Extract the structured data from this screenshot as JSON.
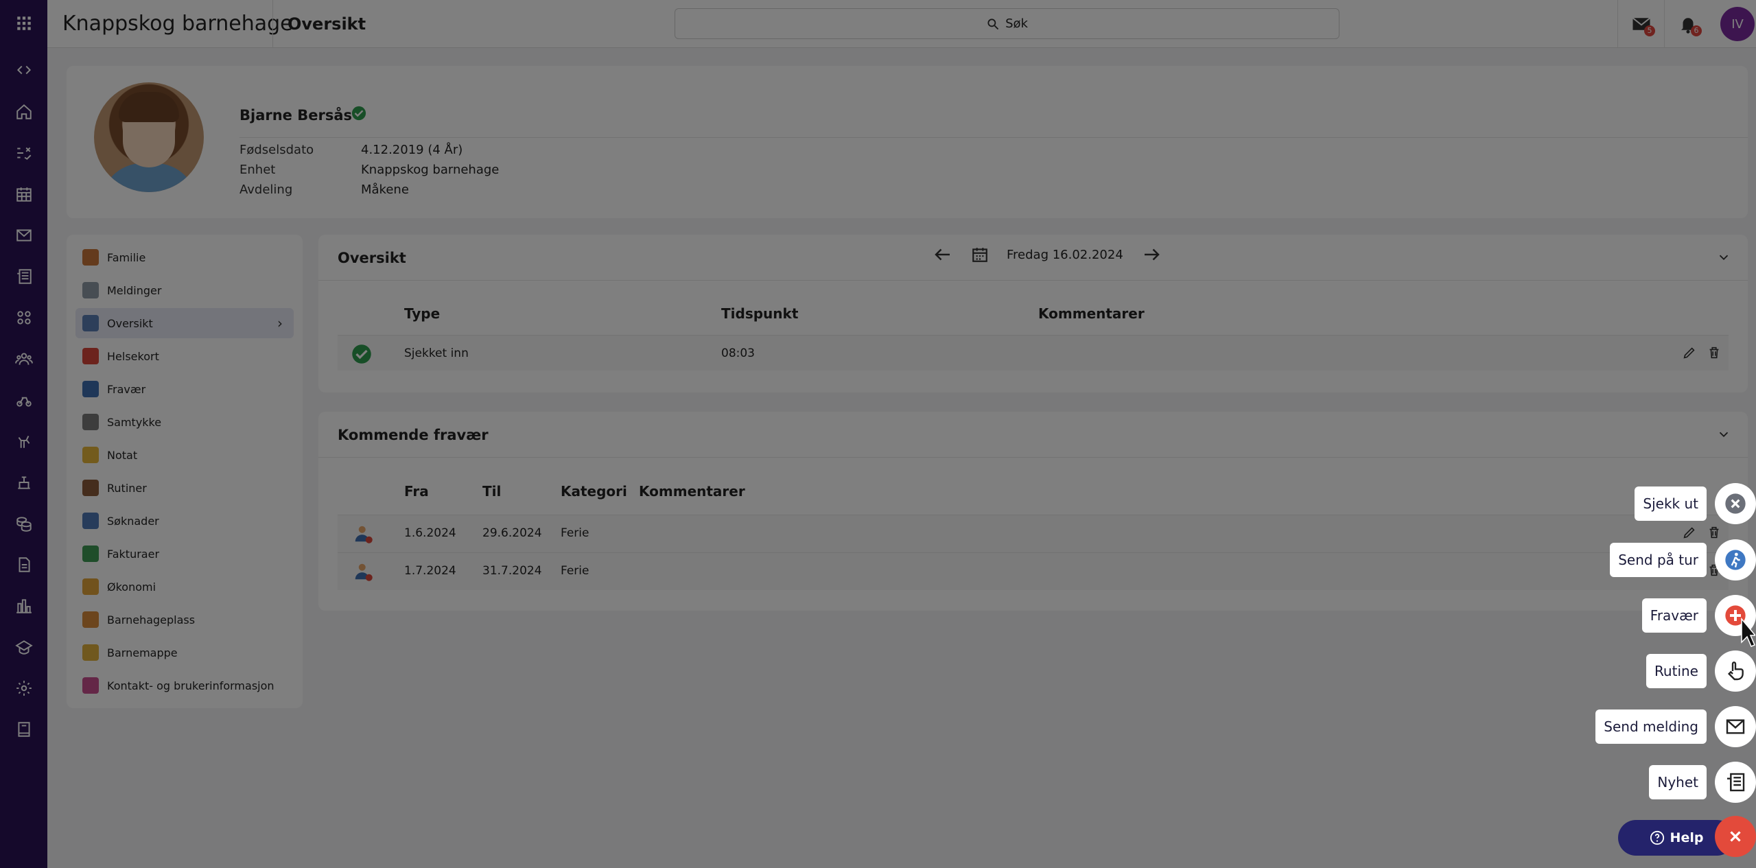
{
  "topbar": {
    "app_title": "Knappskog barnehage",
    "page_title": "Oversikt",
    "search_label": "Søk",
    "mail_badge": "5",
    "bell_badge": "6",
    "user_initials": "IV"
  },
  "profile": {
    "name": "Bjarne Bersås",
    "fields": [
      {
        "label": "Fødselsdato",
        "value": "4.12.2019 (4 År)"
      },
      {
        "label": "Enhet",
        "value": "Knappskog barnehage"
      },
      {
        "label": "Avdeling",
        "value": "Måkene"
      }
    ]
  },
  "menu": {
    "items": [
      {
        "label": "Familie",
        "color": "#c9763a"
      },
      {
        "label": "Meldinger",
        "color": "#8f9aa6"
      },
      {
        "label": "Oversikt",
        "color": "#5b7fb5"
      },
      {
        "label": "Helsekort",
        "color": "#d9473a"
      },
      {
        "label": "Fravær",
        "color": "#3e6fb0"
      },
      {
        "label": "Samtykke",
        "color": "#7b7b7b"
      },
      {
        "label": "Notat",
        "color": "#e6b63a"
      },
      {
        "label": "Rutiner",
        "color": "#8a5a3a"
      },
      {
        "label": "Søknader",
        "color": "#4f79b6"
      },
      {
        "label": "Fakturaer",
        "color": "#3f9a55"
      },
      {
        "label": "Økonomi",
        "color": "#e2a43a"
      },
      {
        "label": "Barnehageplass",
        "color": "#d98a3a"
      },
      {
        "label": "Barnemappe",
        "color": "#e1b13c"
      },
      {
        "label": "Kontakt- og brukerinformasjon",
        "color": "#c84f8e"
      }
    ]
  },
  "overview": {
    "title": "Oversikt",
    "date": "Fredag 16.02.2024",
    "headers": {
      "type": "Type",
      "time": "Tidspunkt",
      "comments": "Kommentarer"
    },
    "rows": [
      {
        "type": "Sjekket inn",
        "time": "08:03",
        "comment": ""
      }
    ]
  },
  "absence": {
    "title": "Kommende fravær",
    "headers": {
      "from": "Fra",
      "to": "Til",
      "category": "Kategori",
      "comments": "Kommentarer"
    },
    "rows": [
      {
        "from": "1.6.2024",
        "to": "29.6.2024",
        "category": "Ferie"
      },
      {
        "from": "1.7.2024",
        "to": "31.7.2024",
        "category": "Ferie"
      }
    ]
  },
  "fab_menu": {
    "items": [
      {
        "label": "Sjekk ut",
        "icon": "close-circle-icon"
      },
      {
        "label": "Send på tur",
        "icon": "walking-icon"
      },
      {
        "label": "Fravær",
        "icon": "plus-circle-icon"
      },
      {
        "label": "Rutine",
        "icon": "hand-pointer-icon"
      },
      {
        "label": "Send melding",
        "icon": "envelope-icon"
      },
      {
        "label": "Nyhet",
        "icon": "newspaper-icon"
      }
    ],
    "help_label": "Help"
  },
  "colors": {
    "nav_bg": "#2a1357",
    "accent_red": "#e34a3b",
    "help_bg": "#24236b",
    "check_green": "#2e9d4e"
  }
}
